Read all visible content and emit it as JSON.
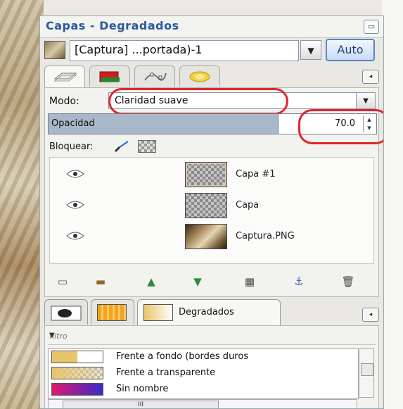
{
  "window": {
    "title": "Capas - Degradados",
    "close": "▭"
  },
  "image_selector": {
    "value": "[Captura] ...portada)-1",
    "auto_label": "Auto"
  },
  "tab_menu_glyph": "◂",
  "mode": {
    "label": "Modo:",
    "value": "Claridad suave"
  },
  "opacity": {
    "label": "Opacidad",
    "value": "70.0",
    "fill_fraction": 0.7
  },
  "lock": {
    "label": "Bloquear:"
  },
  "layers": [
    {
      "name": "Capa #1",
      "thumb": "transparent-photo"
    },
    {
      "name": "Capa",
      "thumb": "transparent"
    },
    {
      "name": "Captura.PNG",
      "thumb": "photo"
    }
  ],
  "gradients_tab": {
    "label": "Degradados"
  },
  "filter": {
    "placeholder": "filtro"
  },
  "gradients": [
    {
      "name": "Frente a fondo (bordes duros",
      "colors": [
        "#e9c56a",
        "#ffffff"
      ]
    },
    {
      "name": "Frente a transparente",
      "colors": [
        "#e9c56a",
        "transparent"
      ]
    },
    {
      "name": "Sin nombre",
      "colors": [
        "#e0196b",
        "#3b2bc9"
      ]
    }
  ],
  "hscroll_thumb": "III",
  "accent_colors": {
    "title": "#2b5a9c",
    "highlight_oval": "#e0252b",
    "opacity_fill": "#a8b8c9"
  }
}
